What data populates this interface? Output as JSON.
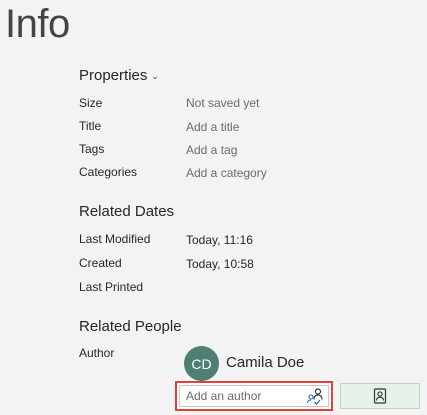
{
  "page": {
    "title": "Info"
  },
  "properties": {
    "header": "Properties",
    "rows": [
      {
        "label": "Size",
        "value": "Not saved yet"
      },
      {
        "label": "Title",
        "value": "Add a title"
      },
      {
        "label": "Tags",
        "value": "Add a tag"
      },
      {
        "label": "Categories",
        "value": "Add a category"
      }
    ]
  },
  "related_dates": {
    "header": "Related Dates",
    "rows": [
      {
        "label": "Last Modified",
        "value": "Today, 11:16"
      },
      {
        "label": "Created",
        "value": "Today, 10:58"
      },
      {
        "label": "Last Printed",
        "value": ""
      }
    ]
  },
  "related_people": {
    "header": "Related People",
    "author_label": "Author",
    "author": {
      "initials": "CD",
      "name": "Camila Doe",
      "avatar_color": "#4f7f72"
    },
    "add_author_placeholder": "Add an author"
  },
  "icons": {
    "properties_chevron": "chevron-down-icon",
    "check_names": "check-names-icon",
    "address_book": "address-book-icon"
  },
  "colors": {
    "highlight_border": "#e0413d",
    "address_book_bg": "#e7f2e8"
  }
}
